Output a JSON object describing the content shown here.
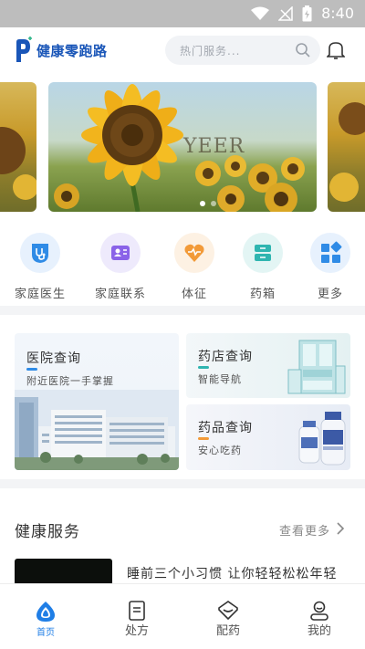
{
  "status_bar": {
    "time": "8:40"
  },
  "header": {
    "logo_text": "健康零跑路",
    "search_placeholder": "热门服务..."
  },
  "banner": {
    "watermark": "YEER",
    "active_dot": 0,
    "dot_count": 2
  },
  "quick_nav": [
    {
      "label": "家庭医生",
      "icon": "stethoscope-icon",
      "color": "#2f8be6"
    },
    {
      "label": "家庭联系",
      "icon": "contact-card-icon",
      "color": "#8a63e8"
    },
    {
      "label": "体征",
      "icon": "heart-pulse-icon",
      "color": "#f29a38"
    },
    {
      "label": "药箱",
      "icon": "medicine-box-icon",
      "color": "#2fb5b0"
    },
    {
      "label": "更多",
      "icon": "grid-more-icon",
      "color": "#2f8be6"
    }
  ],
  "cards": {
    "hospital": {
      "title": "医院查询",
      "subtitle": "附近医院一手掌握",
      "accent": "#2f8be6"
    },
    "pharmacy": {
      "title": "药店查询",
      "subtitle": "智能导航",
      "accent": "#2fb5b0"
    },
    "drug": {
      "title": "药品查询",
      "subtitle": "安心吃药",
      "accent": "#f29a38"
    }
  },
  "services": {
    "title": "健康服务",
    "more": "查看更多",
    "article_title": "睡前三个小习惯 让你轻轻松松年轻十岁"
  },
  "tabbar": [
    {
      "label": "首页",
      "icon": "home-drop-icon",
      "active": true
    },
    {
      "label": "处方",
      "icon": "prescription-icon",
      "active": false
    },
    {
      "label": "配药",
      "icon": "pill-icon",
      "active": false
    },
    {
      "label": "我的",
      "icon": "profile-icon",
      "active": false
    }
  ],
  "colors": {
    "brand": "#1a56b8",
    "active_tab": "#1f7ee6"
  }
}
